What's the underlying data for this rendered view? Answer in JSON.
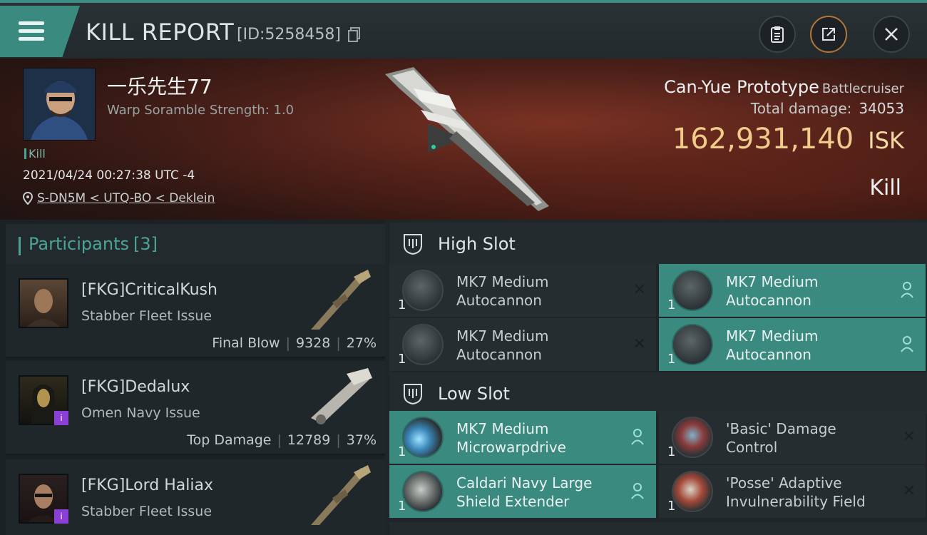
{
  "header": {
    "title": "KILL REPORT",
    "id_text": "[ID:5258458]"
  },
  "victim": {
    "name": "一乐先生77",
    "warp_scramble": "Warp Soramble Strength: 1.0",
    "tag": "Kill",
    "datetime": "2021/04/24 00:27:38 UTC -4",
    "location": "S-DN5M < UTQ-BO < Deklein",
    "ship_name": "Can-Yue Prototype",
    "ship_class": "Battlecruiser",
    "total_damage_label": "Total damage:",
    "total_damage": "34053",
    "isk_value": "162,931,140",
    "isk_unit": "ISK",
    "result": "Kill"
  },
  "participants": {
    "label": "Participants",
    "count": "[3]",
    "rows": [
      {
        "name": "[FKG]CriticalKush",
        "ship": "Stabber Fleet Issue",
        "role": "Final Blow",
        "damage": "9328",
        "pct": "27%"
      },
      {
        "name": "[FKG]Dedalux",
        "ship": "Omen Navy Issue",
        "role": "Top Damage",
        "damage": "12789",
        "pct": "37%"
      },
      {
        "name": "[FKG]Lord Haliax",
        "ship": "Stabber Fleet Issue",
        "role": "",
        "damage": "",
        "pct": ""
      }
    ]
  },
  "slots": {
    "high_label": "High Slot",
    "low_label": "Low Slot",
    "high": [
      {
        "qty": "1",
        "name1": "MK7 Medium",
        "name2": "Autocannon"
      },
      {
        "qty": "1",
        "name1": "MK7 Medium",
        "name2": "Autocannon"
      },
      {
        "qty": "1",
        "name1": "MK7 Medium",
        "name2": "Autocannon"
      },
      {
        "qty": "1",
        "name1": "MK7 Medium",
        "name2": "Autocannon"
      }
    ],
    "low": [
      {
        "qty": "1",
        "name1": "MK7 Medium",
        "name2": "Microwarpdrive"
      },
      {
        "qty": "1",
        "name1": "'Basic' Damage",
        "name2": "Control"
      },
      {
        "qty": "1",
        "name1": "Caldari Navy Large",
        "name2": "Shield Extender"
      },
      {
        "qty": "1",
        "name1": "'Posse' Adaptive",
        "name2": "Invulnerability Field"
      }
    ]
  },
  "colors": {
    "accent": "#3b8a80",
    "isk": "#efcc8c"
  }
}
